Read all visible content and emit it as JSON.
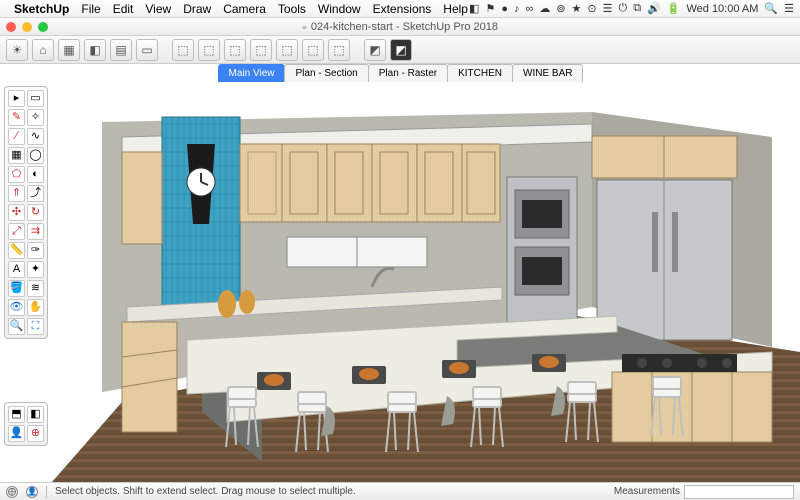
{
  "menubar": {
    "app": "SketchUp",
    "items": [
      "File",
      "Edit",
      "View",
      "Draw",
      "Camera",
      "Tools",
      "Window",
      "Extensions",
      "Help"
    ],
    "clock": "Wed 10:00 AM"
  },
  "window": {
    "title": "024-kitchen-start - SketchUp Pro 2018"
  },
  "scene_tabs": [
    {
      "label": "Main View",
      "active": true
    },
    {
      "label": "Plan - Section",
      "active": false
    },
    {
      "label": "Plan - Raster",
      "active": false
    },
    {
      "label": "KITCHEN",
      "active": false
    },
    {
      "label": "WINE BAR",
      "active": false
    }
  ],
  "status": {
    "hint": "Select objects. Shift to extend select. Drag mouse to select multiple.",
    "measurements_label": "Measurements",
    "measurements_value": ""
  },
  "palette_tools": [
    {
      "g": "▸",
      "n": "select-tool"
    },
    {
      "g": "▭",
      "n": "lasso-tool"
    },
    {
      "g": "✎",
      "n": "line-tool",
      "c": "red"
    },
    {
      "g": "✧",
      "n": "eraser-tool"
    },
    {
      "g": "∕",
      "n": "line2-tool",
      "c": "red"
    },
    {
      "g": "∿",
      "n": "freehand-tool"
    },
    {
      "g": "▦",
      "n": "rectangle-tool"
    },
    {
      "g": "◯",
      "n": "circle-tool"
    },
    {
      "g": "⬠",
      "n": "polygon-tool",
      "c": "red"
    },
    {
      "g": "◐",
      "n": "arc-tool"
    },
    {
      "g": "⇑",
      "n": "pushpull-tool",
      "c": "red"
    },
    {
      "g": "⤴",
      "n": "followme-tool"
    },
    {
      "g": "✣",
      "n": "move-tool",
      "c": "red"
    },
    {
      "g": "↻",
      "n": "rotate-tool",
      "c": "red"
    },
    {
      "g": "⤢",
      "n": "scale-tool",
      "c": "red"
    },
    {
      "g": "⇉",
      "n": "offset-tool",
      "c": "red"
    },
    {
      "g": "📏",
      "n": "tape-tool"
    },
    {
      "g": "✑",
      "n": "dimension-tool"
    },
    {
      "g": "A",
      "n": "text-tool"
    },
    {
      "g": "✦",
      "n": "axes-tool"
    },
    {
      "g": "🪣",
      "n": "paint-tool"
    },
    {
      "g": "≋",
      "n": "texture-tool"
    },
    {
      "g": "👁",
      "n": "orbit-tool",
      "c": "blue"
    },
    {
      "g": "✋",
      "n": "pan-tool",
      "c": "green"
    },
    {
      "g": "🔍",
      "n": "zoom-tool",
      "c": "blue"
    },
    {
      "g": "⛶",
      "n": "zoomext-tool",
      "c": "blue"
    }
  ],
  "palette_tools2": [
    {
      "g": "⬒",
      "n": "section-tool"
    },
    {
      "g": "◧",
      "n": "section-display"
    },
    {
      "g": "👤",
      "n": "walk-tool",
      "c": "blue"
    },
    {
      "g": "⊕",
      "n": "lookaround-tool",
      "c": "red"
    }
  ]
}
